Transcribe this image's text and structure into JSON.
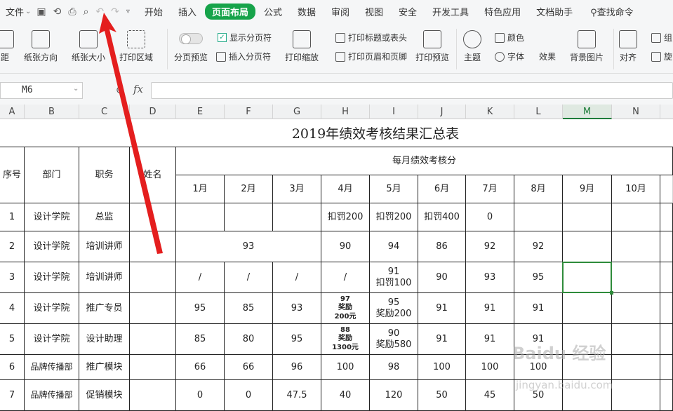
{
  "menubar": {
    "file": "文件",
    "tabs": [
      "开始",
      "插入",
      "页面布局",
      "公式",
      "数据",
      "审阅",
      "视图",
      "安全",
      "开发工具",
      "特色应用",
      "文档助手"
    ],
    "active_tab": "页面布局",
    "search": "查找命令"
  },
  "ribbon": {
    "margin": "距",
    "orientation": "纸张方向",
    "size": "纸张大小",
    "print_area": "打印区域",
    "page_break_preview": "分页预览",
    "show_page_break": "显示分页符",
    "insert_page_break": "插入分页符",
    "print_scale": "打印缩放",
    "print_titles": "打印标题或表头",
    "print_header_footer": "打印页眉和页脚",
    "print_preview": "打印预览",
    "theme": "主题",
    "colors": "颜色",
    "fonts": "字体",
    "effects": "效果",
    "background": "背景图片",
    "align": "对齐",
    "group": "组",
    "rotate": "旋"
  },
  "formula_bar": {
    "cell_ref": "M6",
    "fx": "fx",
    "value": ""
  },
  "columns": [
    "A",
    "B",
    "C",
    "D",
    "E",
    "F",
    "G",
    "H",
    "I",
    "J",
    "K",
    "L",
    "M",
    "N"
  ],
  "selected_column": "M",
  "sheet": {
    "title": "2019年绩效考核结果汇总表",
    "headers": {
      "seq": "序号",
      "dept": "部门",
      "role": "职务",
      "name": "姓名",
      "monthly": "每月绩效考核分"
    },
    "months": [
      "1月",
      "2月",
      "3月",
      "4月",
      "5月",
      "6月",
      "7月",
      "8月",
      "9月",
      "10月"
    ],
    "rows": [
      {
        "seq": "1",
        "dept": "设计学院",
        "role": "总监",
        "cells": [
          "",
          "",
          "",
          "扣罚200",
          "扣罚200",
          "扣罚400",
          "0",
          "",
          "",
          ""
        ]
      },
      {
        "seq": "2",
        "dept": "设计学院",
        "role": "培训讲师",
        "merged": "93",
        "cells": [
          "",
          "",
          "",
          "90",
          "94",
          "86",
          "92",
          "92",
          "",
          ""
        ]
      },
      {
        "seq": "3",
        "dept": "设计学院",
        "role": "培训讲师",
        "cells": [
          "/",
          "/",
          "/",
          "/",
          "91\n扣罚100",
          "90",
          "93",
          "95",
          "",
          ""
        ]
      },
      {
        "seq": "4",
        "dept": "设计学院",
        "role": "推广专员",
        "cells": [
          "95",
          "85",
          "93",
          "97\n奖励\n200元",
          "95\n奖励200",
          "91",
          "91",
          "91",
          "",
          ""
        ]
      },
      {
        "seq": "5",
        "dept": "设计学院",
        "role": "设计助理",
        "cells": [
          "85",
          "80",
          "95",
          "88\n奖励\n1300元",
          "90\n奖励580",
          "91",
          "91",
          "91",
          "",
          ""
        ]
      },
      {
        "seq": "6",
        "dept": "品牌传播部",
        "role": "推广模块",
        "cells": [
          "66",
          "66",
          "96",
          "100",
          "98",
          "100",
          "100",
          "100",
          "",
          ""
        ]
      },
      {
        "seq": "7",
        "dept": "品牌传播部",
        "role": "促销模块",
        "cells": [
          "0",
          "0",
          "47.5",
          "40",
          "120",
          "50",
          "45",
          "50",
          "",
          ""
        ]
      }
    ]
  },
  "watermark": {
    "line1": "Baidu 经验",
    "line2": "jingyan.baidu.com"
  }
}
